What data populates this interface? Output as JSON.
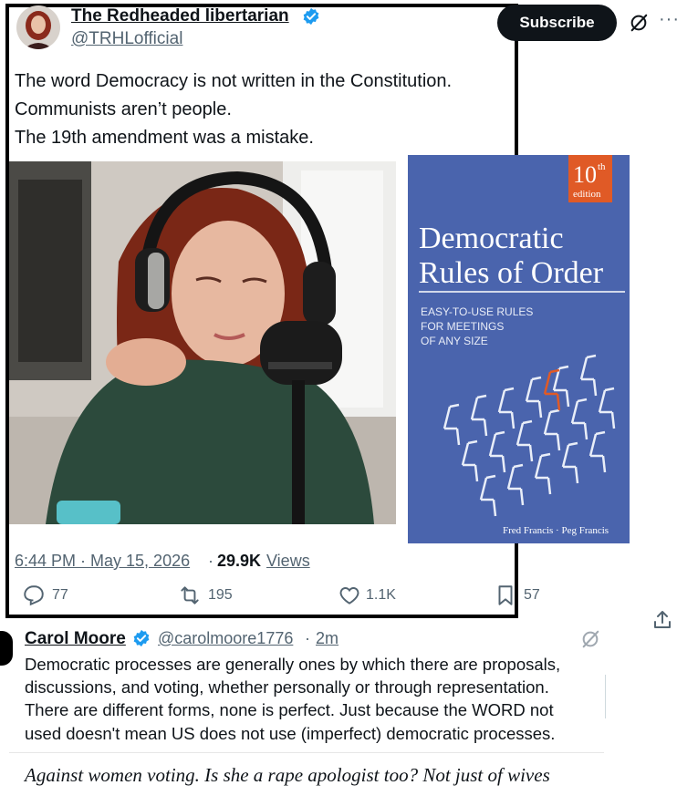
{
  "tweet": {
    "display_name": "The Redheaded libertarian",
    "handle": "@TRHLofficial",
    "subscribe_label": "Subscribe",
    "more_label": "···",
    "lines": [
      "The word Democracy is not written in the Constitution.",
      "Communists aren’t people.",
      "The 19th amendment was a mistake."
    ],
    "timestamp": "6:44 PM · May 15, 2026",
    "views_separator": "·",
    "views_count": "29.9K",
    "views_label": " Views",
    "replies": "77",
    "retweets": "195",
    "likes": "1.1K",
    "bookmarks": "57"
  },
  "book": {
    "edition_number": "10",
    "edition_suffix": "th",
    "edition_word": "edition",
    "title_line1": "Democratic",
    "title_line2": "Rules of Order",
    "subtitle_lines": [
      "EASY-TO-USE RULES",
      "FOR MEETINGS",
      "OF ANY SIZE"
    ],
    "authors": "Fred Francis · Peg Francis",
    "cover_color": "#4a64ad",
    "accent_color": "#e05a26"
  },
  "reply": {
    "display_name": "Carol Moore",
    "handle": "@carolmoore1776",
    "separator": "·",
    "time": "2m",
    "lines": [
      "Democratic processes are generally ones by which there are proposals,",
      "discussions, and voting, whether personally or through representation.",
      "There are different forms, none is perfect.  Just because the WORD not",
      "used doesn't mean US does not use (imperfect) democratic processes."
    ]
  },
  "quote_text": "Against women voting. Is she a rape apologist too? Not just of wives",
  "colors": {
    "text_primary": "#0f1419",
    "text_secondary": "#536471",
    "verified_blue": "#1d9bf0"
  }
}
